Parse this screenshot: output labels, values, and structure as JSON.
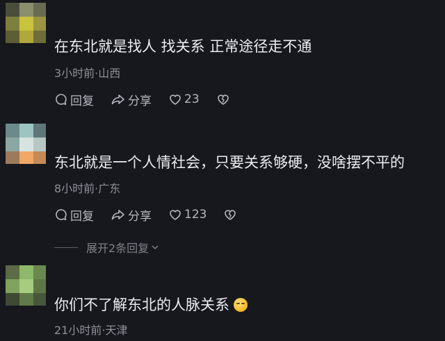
{
  "comments": [
    {
      "text": "在东北就是找人 找关系 正常途径走不通",
      "time_location": "3小时前·山西",
      "reply_label": "回复",
      "share_label": "分享",
      "likes": "23"
    },
    {
      "text": "东北就是一个人情社会，只要关系够硬，没啥摆不平的",
      "time_location": "8小时前·广东",
      "reply_label": "回复",
      "share_label": "分享",
      "likes": "123",
      "expand_label": "展开2条回复"
    },
    {
      "text": "你们不了解东北的人脉关系",
      "emoji": "smirk-emoji",
      "time_location": "21小时前·天津"
    }
  ],
  "icons": {
    "reply": "reply-bubble-icon",
    "share": "share-arrow-icon",
    "like": "heart-icon",
    "dislike": "broken-heart-icon",
    "expand": "chevron-down-icon"
  },
  "colors": {
    "background": "#16181d",
    "text": "#ecedf1",
    "meta": "#8e9199",
    "action": "#b5b8c0"
  }
}
